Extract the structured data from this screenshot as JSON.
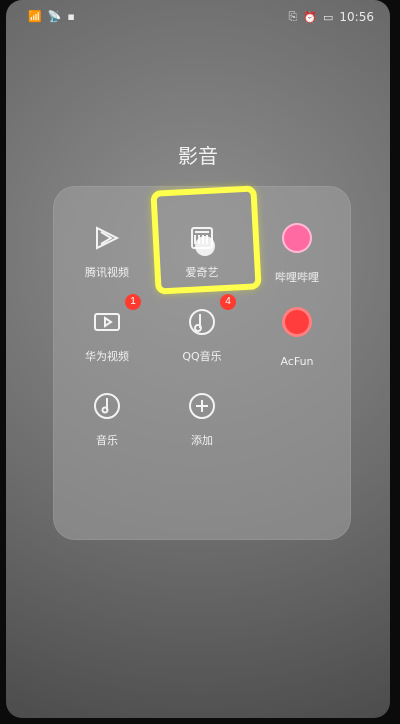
{
  "status_bar": {
    "time": "10:56",
    "left_icons": [
      "signal-icon",
      "wifi-icon",
      "notification-icon"
    ],
    "right_icons": [
      "nfc-icon",
      "alarm-icon",
      "battery-icon"
    ]
  },
  "folder": {
    "title": "影音",
    "apps": [
      {
        "label": "腾讯视频",
        "icon": "tencent-video-icon",
        "badge": ""
      },
      {
        "label": "爱奇艺",
        "icon": "iqiyi-icon",
        "badge": ""
      },
      {
        "label": "哔哩哔哩",
        "icon": "bilibili-icon",
        "badge": ""
      },
      {
        "label": "华为视频",
        "icon": "huawei-video-icon",
        "badge": "1"
      },
      {
        "label": "QQ音乐",
        "icon": "qq-music-icon",
        "badge": "4"
      },
      {
        "label": "AcFun",
        "icon": "acfun-icon",
        "badge": ""
      },
      {
        "label": "音乐",
        "icon": "music-icon",
        "badge": ""
      },
      {
        "label": "添加",
        "icon": "add-icon",
        "badge": ""
      }
    ]
  },
  "colors": {
    "highlight": "#ffff4d",
    "badge": "#ff3b30",
    "bilibili": "#ff6aa3",
    "acfun": "#ff3d3d"
  }
}
